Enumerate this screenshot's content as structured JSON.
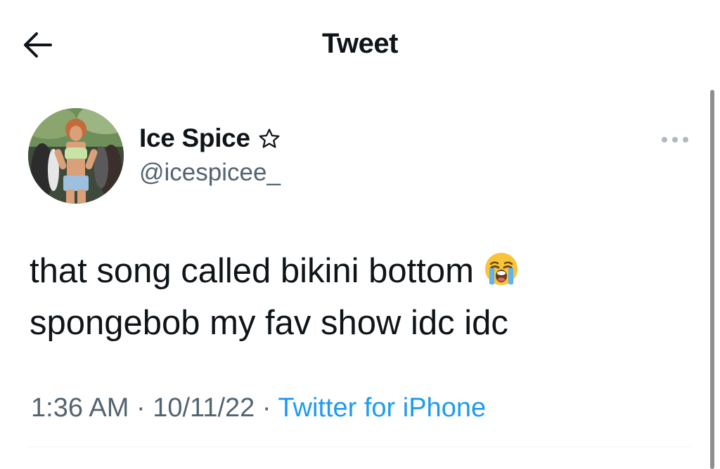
{
  "header": {
    "title": "Tweet",
    "back_icon": "arrow-left-icon"
  },
  "author": {
    "display_name": "Ice Spice",
    "badge_icon": "star-outline-icon",
    "handle": "@icespicee_",
    "avatar_icon": "profile-photo-avatar"
  },
  "more_icon": "more-horizontal-icon",
  "tweet": {
    "line1": "that song called bikini bottom",
    "emoji": "loudly-crying-face-emoji",
    "line2": "spongebob my fav show idc idc"
  },
  "meta": {
    "time": "1:36 AM",
    "separator": " · ",
    "date": "10/11/22",
    "source": "Twitter for iPhone"
  },
  "colors": {
    "text": "#0f1419",
    "secondary": "#536471",
    "link": "#1d9bf0",
    "divider": "#eff3f4"
  }
}
